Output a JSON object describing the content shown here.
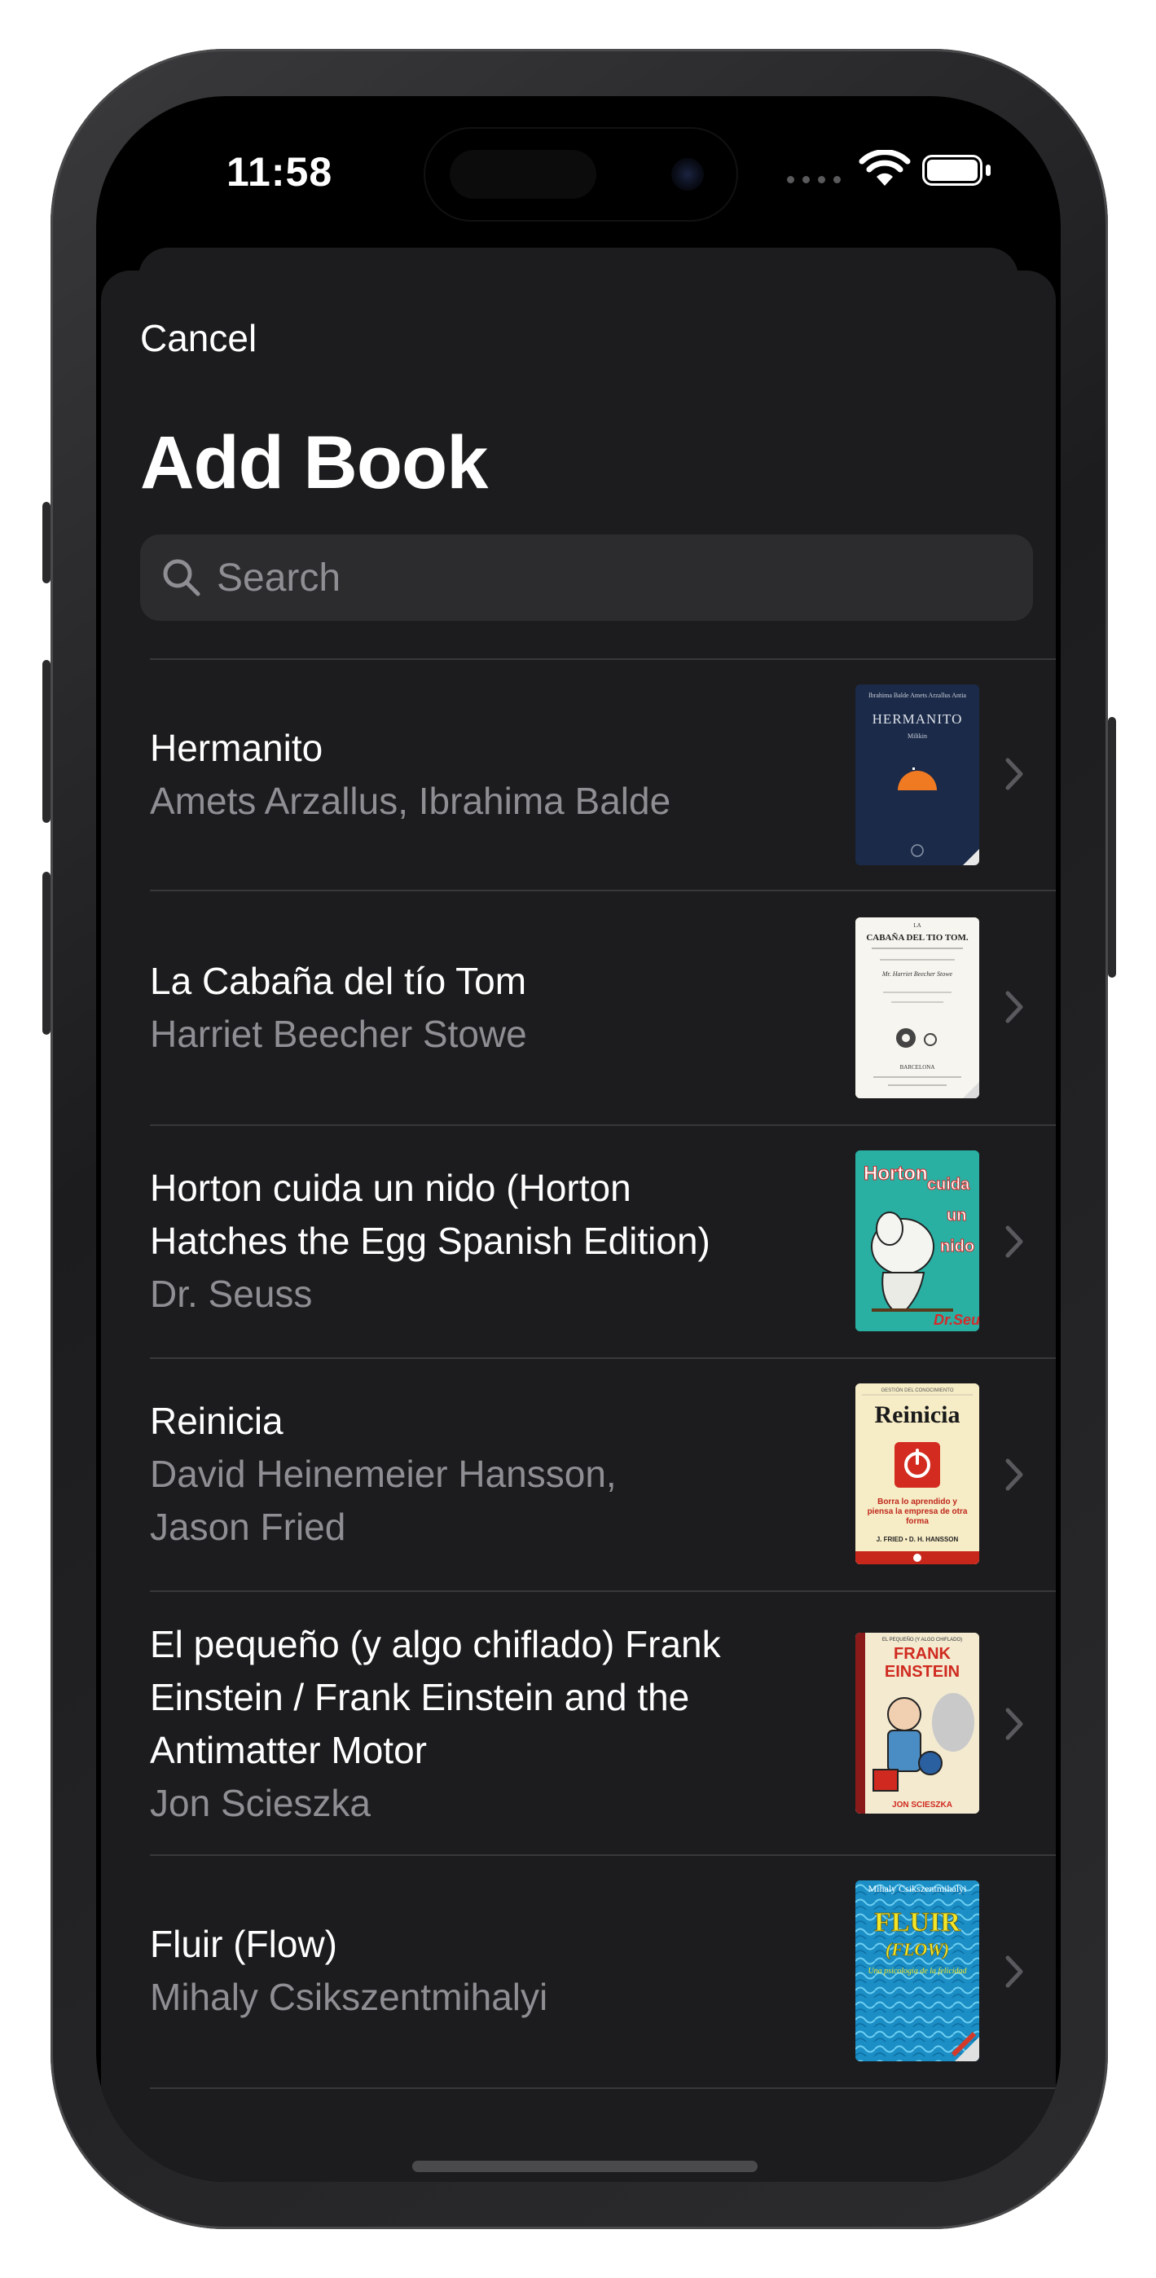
{
  "status_bar": {
    "time": "11:58"
  },
  "nav": {
    "cancel_label": "Cancel",
    "title": "Add Book"
  },
  "search": {
    "placeholder": "Search",
    "value": ""
  },
  "books": [
    {
      "title": "Hermanito",
      "author": "Amets Arzallus, Ibrahima Balde",
      "cover": {
        "top_text": "Ibrahima Balde\nAmets Arzallus Antia",
        "main_text": "HERMANITO",
        "sub_text": "Milikin"
      }
    },
    {
      "title": "La Cabaña del tío Tom",
      "author": "Harriet Beecher Stowe",
      "cover": {
        "top_text": "LA",
        "main_text": "CABAÑA DEL TIO TOM.",
        "sub_text": "Mr. Harriet Beecher Stowe",
        "footer_text": "BARCELONA"
      }
    },
    {
      "title": "Horton cuida un nido (Horton\nHatches the Egg Spanish Edition)",
      "author": "Dr. Seuss",
      "cover": {
        "word1": "Horton",
        "word2": "cuida",
        "word3": "un",
        "word4": "nido",
        "brand": "Dr.Seuss"
      }
    },
    {
      "title": "Reinicia",
      "author": "David Heinemeier Hansson,\nJason Fried",
      "cover": {
        "top_text": "GESTIÓN DEL CONOCIMIENTO",
        "main_text": "Reinicia",
        "sub_text": "Borra lo aprendido y piensa la empresa de otra forma",
        "authors_text": "J. FRIED • D. H. HANSSON"
      }
    },
    {
      "title": "El pequeño (y algo chiflado) Frank\nEinstein / Frank Einstein and the\nAntimatter Motor",
      "author": "Jon Scieszka",
      "cover": {
        "top_text": "EL PEQUEÑO (Y ALGO CHIFLADO)",
        "main_text1": "FRANK",
        "main_text2": "EINSTEIN",
        "author_text": "JON SCIESZKA"
      }
    },
    {
      "title": "Fluir (Flow)",
      "author": "Mihaly Csikszentmihalyi",
      "cover": {
        "top_text": "Mihaly Csikszentmihalyi",
        "main_text1": "FLUIR",
        "main_text2": "(FLOW)",
        "sub_text": "Una psicología de la felicidad"
      }
    }
  ]
}
